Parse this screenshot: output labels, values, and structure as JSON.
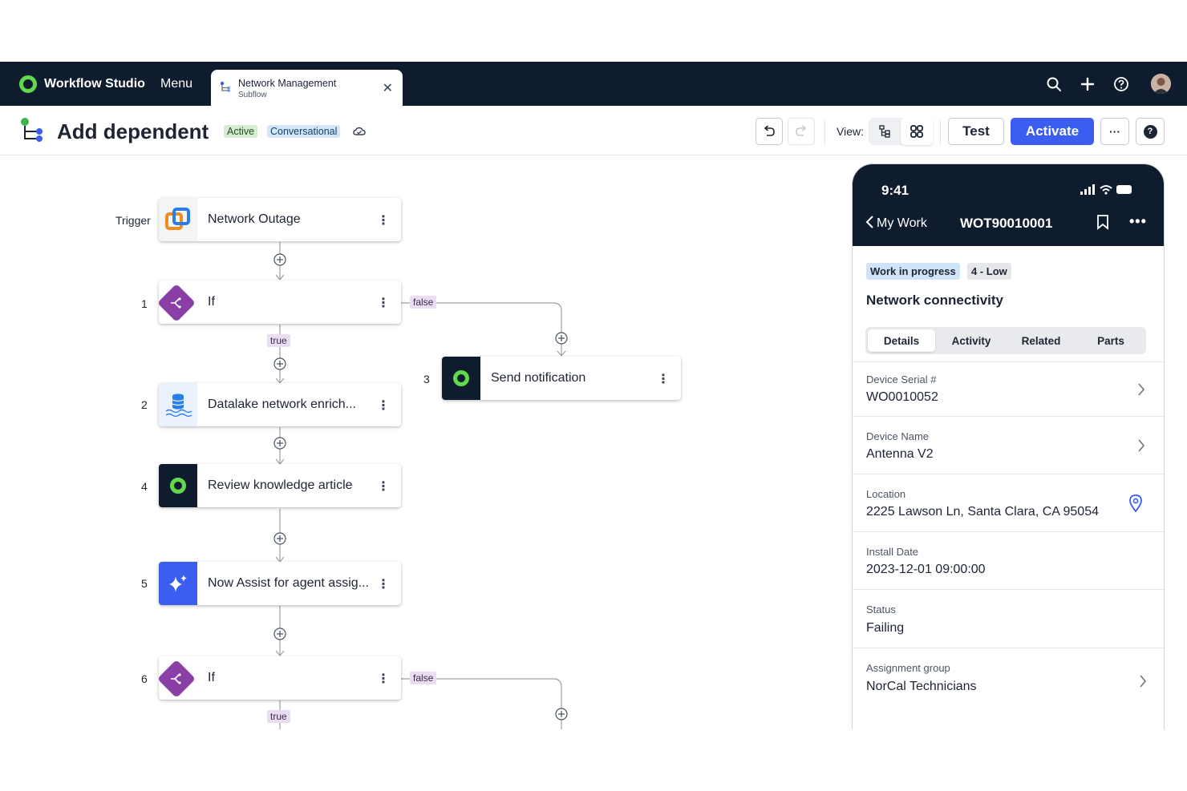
{
  "app": {
    "name": "Workflow Studio",
    "menu_label": "Menu"
  },
  "tab": {
    "title": "Network Management",
    "subtitle": "Subflow",
    "close_glyph": "✕"
  },
  "colors": {
    "nav_bg": "#0f1c2e",
    "brand_green": "#62d84e",
    "primary": "#3b5ef0",
    "if_purple": "#8a3fa6"
  },
  "header": {
    "title": "Add dependent",
    "badges": {
      "active": "Active",
      "conversational": "Conversational"
    },
    "view_label": "View:",
    "test_label": "Test",
    "activate_label": "Activate",
    "more_glyph": "···",
    "help_glyph": "?"
  },
  "flow": {
    "trigger_label": "Trigger",
    "trigger_node": "Network Outage",
    "steps": [
      {
        "num": "1",
        "label": "If"
      },
      {
        "num": "2",
        "label": "Datalake network enrich..."
      },
      {
        "num": "3",
        "label": "Send notification"
      },
      {
        "num": "4",
        "label": "Review knowledge article"
      },
      {
        "num": "5",
        "label": "Now Assist for agent assig..."
      },
      {
        "num": "6",
        "label": "If"
      }
    ],
    "true_label": "true",
    "false_label": "false",
    "more_glyph": "⋮"
  },
  "phone": {
    "time": "9:41",
    "back_label": "My Work",
    "record_id": "WOT90010001",
    "more_glyph": "•••",
    "state": "Work in progress",
    "priority": "4 - Low",
    "heading": "Network connectivity",
    "tabs": [
      "Details",
      "Activity",
      "Related",
      "Parts"
    ],
    "fields": [
      {
        "label": "Device Serial #",
        "value": "WO0010052"
      },
      {
        "label": "Device Name",
        "value": "Antenna V2"
      },
      {
        "label": "Location",
        "value": "2225 Lawson Ln, Santa Clara, CA 95054"
      },
      {
        "label": "Install Date",
        "value": "2023-12-01 09:00:00"
      },
      {
        "label": "Status",
        "value": "Failing"
      },
      {
        "label": "Assignment group",
        "value": "NorCal Technicians"
      }
    ]
  },
  "icons": [
    "search-icon",
    "plus-icon",
    "help-circle-icon",
    "undo-icon",
    "redo-icon",
    "tree-view-icon",
    "grid-view-icon",
    "cloud-icon",
    "chevron-right-icon",
    "location-pin-icon",
    "bookmark-icon"
  ]
}
